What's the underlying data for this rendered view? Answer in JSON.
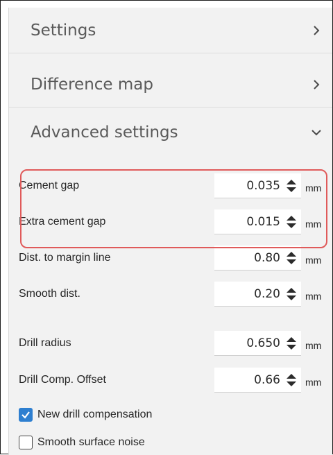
{
  "sections": {
    "settings": {
      "label": "Settings",
      "state": "collapsed",
      "icon": "chevron-right-icon"
    },
    "difference_map": {
      "label": "Difference map",
      "state": "collapsed",
      "icon": "chevron-right-icon"
    },
    "advanced_settings": {
      "label": "Advanced settings",
      "state": "expanded",
      "icon": "chevron-down-icon"
    }
  },
  "fields": {
    "cement_gap": {
      "label": "Cement gap",
      "value": "0.035",
      "unit": "mm"
    },
    "extra_cement_gap": {
      "label": "Extra cement gap",
      "value": "0.015",
      "unit": "mm"
    },
    "dist_to_margin_line": {
      "label": "Dist. to margin line",
      "value": "0.80",
      "unit": "mm"
    },
    "smooth_dist": {
      "label": "Smooth dist.",
      "value": "0.20",
      "unit": "mm"
    },
    "drill_radius": {
      "label": "Drill radius",
      "value": "0.650",
      "unit": "mm"
    },
    "drill_comp_offset": {
      "label": "Drill Comp. Offset",
      "value": "0.66",
      "unit": "mm"
    }
  },
  "checkboxes": {
    "new_drill_compensation": {
      "label": "New drill compensation",
      "checked": true
    },
    "smooth_surface_noise": {
      "label": "Smooth surface noise",
      "checked": false
    }
  },
  "colors": {
    "panel_background": "#f2f2f2",
    "highlight_outline": "#e05a5a",
    "checkbox_accent": "#2e7fd0",
    "header_text": "#5a5a5a"
  }
}
